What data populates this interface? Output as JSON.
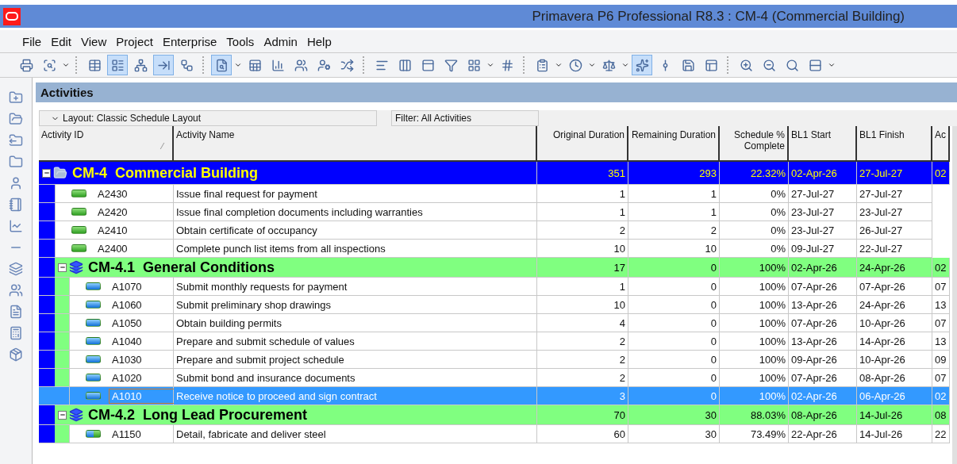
{
  "window": {
    "title": "Primavera P6 Professional R8.3 : CM-4 (Commercial Building)"
  },
  "menu": [
    "File",
    "Edit",
    "View",
    "Project",
    "Enterprise",
    "Tools",
    "Admin",
    "Help"
  ],
  "toolbar": [
    {
      "pressed": false
    },
    {
      "pressed": false
    },
    {
      "pressed": false
    },
    {
      "pressed": true
    },
    {
      "pressed": false
    },
    {
      "pressed": true
    },
    {
      "pressed": false
    },
    {
      "pressed": true
    },
    {
      "pressed": false
    },
    {
      "pressed": false
    },
    {
      "pressed": false
    },
    {
      "pressed": false
    },
    {
      "pressed": false
    },
    {
      "pressed": false
    },
    {
      "pressed": false
    },
    {
      "pressed": false
    },
    {
      "pressed": false
    },
    {
      "pressed": false
    },
    {
      "pressed": false
    },
    {
      "pressed": false
    },
    {
      "pressed": false
    },
    {
      "pressed": false
    },
    {
      "pressed": true
    },
    {
      "pressed": false
    },
    {
      "pressed": false
    },
    {
      "pressed": false
    },
    {
      "pressed": false
    },
    {
      "pressed": false
    },
    {
      "pressed": false
    },
    {
      "pressed": false
    }
  ],
  "panel": {
    "title": "Activities",
    "layout": "Layout: Classic Schedule Layout",
    "filter": "Filter: All Activities"
  },
  "table": {
    "columns": [
      "Activity ID",
      "Activity Name",
      "Original Duration",
      "Remaining Duration",
      "Schedule % Complete",
      "BL1 Start",
      "BL1 Finish",
      "Ac"
    ],
    "rows": [
      {
        "kind": "wbs",
        "code": "CM-4",
        "name": "Commercial Building",
        "color": "#0000ff",
        "expanded": true,
        "values": [
          "351",
          "293",
          "22.32%",
          "02-Apr-26",
          "27-Jul-27",
          "02"
        ],
        "children": [
          {
            "kind": "activity",
            "level": 0,
            "selected": false,
            "id": "A2430",
            "name": "Issue final request for payment",
            "values": [
              "1",
              "1",
              "0%",
              "27-Jul-27",
              "27-Jul-27"
            ]
          },
          {
            "kind": "activity",
            "level": 0,
            "selected": false,
            "id": "A2420",
            "name": "Issue final completion documents including warranties",
            "values": [
              "1",
              "1",
              "0%",
              "23-Jul-27",
              "23-Jul-27"
            ]
          },
          {
            "kind": "activity",
            "level": 0,
            "selected": false,
            "id": "A2410",
            "name": "Obtain certificate of occupancy",
            "values": [
              "2",
              "2",
              "0%",
              "23-Jul-27",
              "26-Jul-27"
            ]
          },
          {
            "kind": "activity",
            "level": 0,
            "selected": false,
            "id": "A2400",
            "name": "Complete punch list items from all inspections",
            "values": [
              "10",
              "10",
              "0%",
              "09-Jul-27",
              "22-Jul-27"
            ]
          },
          {
            "kind": "wbs",
            "code": "CM-4.1",
            "name": "General Conditions",
            "color": "#80ff80",
            "expanded": true,
            "values": [
              "17",
              "0",
              "100%",
              "02-Apr-26",
              "24-Apr-26",
              "02"
            ],
            "children": [
              {
                "kind": "activity",
                "level": 1,
                "selected": false,
                "id": "A1070",
                "name": "Submit monthly requests for payment",
                "values": [
                  "1",
                  "0",
                  "100%",
                  "07-Apr-26",
                  "07-Apr-26",
                  "07"
                ]
              },
              {
                "kind": "activity",
                "level": 1,
                "selected": false,
                "id": "A1060",
                "name": "Submit preliminary shop drawings",
                "values": [
                  "10",
                  "0",
                  "100%",
                  "13-Apr-26",
                  "24-Apr-26",
                  "13"
                ]
              },
              {
                "kind": "activity",
                "level": 1,
                "selected": false,
                "id": "A1050",
                "name": "Obtain building permits",
                "values": [
                  "4",
                  "0",
                  "100%",
                  "07-Apr-26",
                  "10-Apr-26",
                  "07"
                ]
              },
              {
                "kind": "activity",
                "level": 1,
                "selected": false,
                "id": "A1040",
                "name": "Prepare and submit schedule of values",
                "values": [
                  "2",
                  "0",
                  "100%",
                  "13-Apr-26",
                  "14-Apr-26",
                  "13"
                ]
              },
              {
                "kind": "activity",
                "level": 1,
                "selected": false,
                "id": "A1030",
                "name": "Prepare and submit project schedule",
                "values": [
                  "2",
                  "0",
                  "100%",
                  "09-Apr-26",
                  "10-Apr-26",
                  "09"
                ]
              },
              {
                "kind": "activity",
                "level": 1,
                "selected": false,
                "id": "A1020",
                "name": "Submit bond and insurance documents",
                "values": [
                  "2",
                  "0",
                  "100%",
                  "07-Apr-26",
                  "08-Apr-26",
                  "07"
                ]
              },
              {
                "kind": "activity",
                "level": 1,
                "selected": true,
                "id": "A1010",
                "name": "Receive notice to proceed and sign contract",
                "values": [
                  "3",
                  "0",
                  "100%",
                  "02-Apr-26",
                  "06-Apr-26",
                  "02"
                ]
              }
            ]
          },
          {
            "kind": "wbs",
            "code": "CM-4.2",
            "name": "Long Lead Procurement",
            "color": "#80ff80",
            "expanded": true,
            "values": [
              "70",
              "30",
              "88.03%",
              "08-Apr-26",
              "14-Jul-26",
              "08"
            ],
            "children": [
              {
                "kind": "activity",
                "level": 0.5,
                "selected": false,
                "id": "A1150",
                "name": "Detail, fabricate and deliver steel",
                "values": [
                  "60",
                  "30",
                  "73.49%",
                  "22-Apr-26",
                  "14-Jul-26",
                  "22"
                ]
              }
            ]
          }
        ]
      }
    ]
  }
}
